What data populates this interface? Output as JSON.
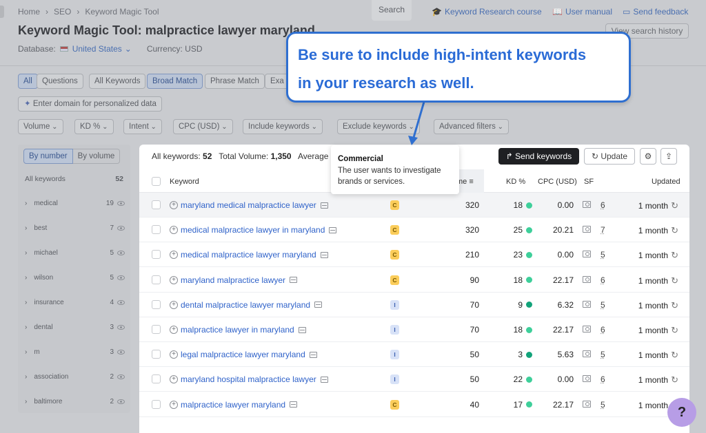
{
  "breadcrumb": [
    "Home",
    "SEO",
    "Keyword Magic Tool"
  ],
  "search_button": "Search",
  "top_links": {
    "course": "Keyword Research course",
    "manual": "User manual",
    "feedback": "Send feedback"
  },
  "view_history": "View search history",
  "title_prefix": "Keyword Magic Tool:",
  "title_query": "malpractice lawyer maryland",
  "database_label": "Database:",
  "database_value": "United States",
  "currency_label": "Currency: USD",
  "match_tabs": [
    "All",
    "Questions",
    "All Keywords",
    "Broad Match",
    "Phrase Match",
    "Exa"
  ],
  "personalized_placeholder": "Enter domain for personalized data",
  "filters": [
    "Volume",
    "KD %",
    "Intent",
    "CPC (USD)",
    "Include keywords",
    "Exclude keywords",
    "Advanced filters"
  ],
  "sidebar": {
    "toggle": [
      "By number",
      "By volume"
    ],
    "header_label": "All keywords",
    "header_count": "52",
    "items": [
      {
        "label": "medical",
        "count": "19"
      },
      {
        "label": "best",
        "count": "7"
      },
      {
        "label": "michael",
        "count": "5"
      },
      {
        "label": "wilson",
        "count": "5"
      },
      {
        "label": "insurance",
        "count": "4"
      },
      {
        "label": "dental",
        "count": "3"
      },
      {
        "label": "m",
        "count": "3"
      },
      {
        "label": "association",
        "count": "2"
      },
      {
        "label": "baltimore",
        "count": "2"
      }
    ]
  },
  "summary": {
    "all_label": "All keywords:",
    "all_value": "52",
    "vol_label": "Total Volume:",
    "vol_value": "1,350",
    "avg_label": "Average"
  },
  "buttons": {
    "send": "Send keywords",
    "update": "Update"
  },
  "columns": {
    "keyword": "Keyword",
    "volume": "me",
    "kd": "KD %",
    "cpc": "CPC (USD)",
    "sf": "SF",
    "updated": "Updated"
  },
  "rows": [
    {
      "keyword": "maryland medical malpractice lawyer",
      "intent": "C",
      "volume": "320",
      "kd": "18",
      "kd_color": "#3ecf9a",
      "cpc": "0.00",
      "sf": "6",
      "updated": "1 month"
    },
    {
      "keyword": "medical malpractice lawyer in maryland",
      "intent": "C",
      "volume": "320",
      "kd": "25",
      "kd_color": "#3ecf9a",
      "cpc": "20.21",
      "sf": "7",
      "updated": "1 month"
    },
    {
      "keyword": "medical malpractice lawyer maryland",
      "intent": "C",
      "volume": "210",
      "kd": "23",
      "kd_color": "#3ecf9a",
      "cpc": "0.00",
      "sf": "5",
      "updated": "1 month"
    },
    {
      "keyword": "maryland malpractice lawyer",
      "intent": "C",
      "volume": "90",
      "kd": "18",
      "kd_color": "#3ecf9a",
      "cpc": "22.17",
      "sf": "6",
      "updated": "1 month"
    },
    {
      "keyword": "dental malpractice lawyer maryland",
      "intent": "I",
      "volume": "70",
      "kd": "9",
      "kd_color": "#12a37a",
      "cpc": "6.32",
      "sf": "5",
      "updated": "1 month"
    },
    {
      "keyword": "malpractice lawyer in maryland",
      "intent": "I",
      "volume": "70",
      "kd": "18",
      "kd_color": "#3ecf9a",
      "cpc": "22.17",
      "sf": "6",
      "updated": "1 month"
    },
    {
      "keyword": "legal malpractice lawyer maryland",
      "intent": "I",
      "volume": "50",
      "kd": "3",
      "kd_color": "#12a37a",
      "cpc": "5.63",
      "sf": "5",
      "updated": "1 month"
    },
    {
      "keyword": "maryland hospital malpractice lawyer",
      "intent": "I",
      "volume": "50",
      "kd": "22",
      "kd_color": "#3ecf9a",
      "cpc": "0.00",
      "sf": "6",
      "updated": "1 month"
    },
    {
      "keyword": "malpractice lawyer maryland",
      "intent": "C",
      "volume": "40",
      "kd": "17",
      "kd_color": "#3ecf9a",
      "cpc": "22.17",
      "sf": "5",
      "updated": "1 month"
    }
  ],
  "tooltip": {
    "title": "Commercial",
    "body": "The user wants to investigate brands or services."
  },
  "callout": {
    "line1": "Be sure to include high-intent keywords",
    "line2": "in your research as well."
  },
  "help": "?"
}
